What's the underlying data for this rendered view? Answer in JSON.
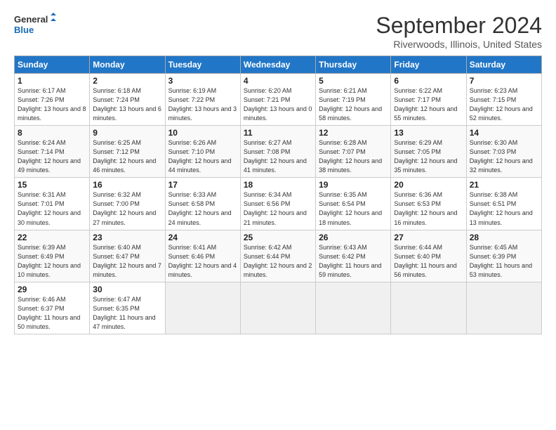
{
  "logo": {
    "line1": "General",
    "line2": "Blue"
  },
  "title": "September 2024",
  "location": "Riverwoods, Illinois, United States",
  "days_of_week": [
    "Sunday",
    "Monday",
    "Tuesday",
    "Wednesday",
    "Thursday",
    "Friday",
    "Saturday"
  ],
  "weeks": [
    [
      {
        "day": "1",
        "sunrise": "6:17 AM",
        "sunset": "7:26 PM",
        "daylight": "13 hours and 8 minutes."
      },
      {
        "day": "2",
        "sunrise": "6:18 AM",
        "sunset": "7:24 PM",
        "daylight": "13 hours and 6 minutes."
      },
      {
        "day": "3",
        "sunrise": "6:19 AM",
        "sunset": "7:22 PM",
        "daylight": "13 hours and 3 minutes."
      },
      {
        "day": "4",
        "sunrise": "6:20 AM",
        "sunset": "7:21 PM",
        "daylight": "13 hours and 0 minutes."
      },
      {
        "day": "5",
        "sunrise": "6:21 AM",
        "sunset": "7:19 PM",
        "daylight": "12 hours and 58 minutes."
      },
      {
        "day": "6",
        "sunrise": "6:22 AM",
        "sunset": "7:17 PM",
        "daylight": "12 hours and 55 minutes."
      },
      {
        "day": "7",
        "sunrise": "6:23 AM",
        "sunset": "7:15 PM",
        "daylight": "12 hours and 52 minutes."
      }
    ],
    [
      {
        "day": "8",
        "sunrise": "6:24 AM",
        "sunset": "7:14 PM",
        "daylight": "12 hours and 49 minutes."
      },
      {
        "day": "9",
        "sunrise": "6:25 AM",
        "sunset": "7:12 PM",
        "daylight": "12 hours and 46 minutes."
      },
      {
        "day": "10",
        "sunrise": "6:26 AM",
        "sunset": "7:10 PM",
        "daylight": "12 hours and 44 minutes."
      },
      {
        "day": "11",
        "sunrise": "6:27 AM",
        "sunset": "7:08 PM",
        "daylight": "12 hours and 41 minutes."
      },
      {
        "day": "12",
        "sunrise": "6:28 AM",
        "sunset": "7:07 PM",
        "daylight": "12 hours and 38 minutes."
      },
      {
        "day": "13",
        "sunrise": "6:29 AM",
        "sunset": "7:05 PM",
        "daylight": "12 hours and 35 minutes."
      },
      {
        "day": "14",
        "sunrise": "6:30 AM",
        "sunset": "7:03 PM",
        "daylight": "12 hours and 32 minutes."
      }
    ],
    [
      {
        "day": "15",
        "sunrise": "6:31 AM",
        "sunset": "7:01 PM",
        "daylight": "12 hours and 30 minutes."
      },
      {
        "day": "16",
        "sunrise": "6:32 AM",
        "sunset": "7:00 PM",
        "daylight": "12 hours and 27 minutes."
      },
      {
        "day": "17",
        "sunrise": "6:33 AM",
        "sunset": "6:58 PM",
        "daylight": "12 hours and 24 minutes."
      },
      {
        "day": "18",
        "sunrise": "6:34 AM",
        "sunset": "6:56 PM",
        "daylight": "12 hours and 21 minutes."
      },
      {
        "day": "19",
        "sunrise": "6:35 AM",
        "sunset": "6:54 PM",
        "daylight": "12 hours and 18 minutes."
      },
      {
        "day": "20",
        "sunrise": "6:36 AM",
        "sunset": "6:53 PM",
        "daylight": "12 hours and 16 minutes."
      },
      {
        "day": "21",
        "sunrise": "6:38 AM",
        "sunset": "6:51 PM",
        "daylight": "12 hours and 13 minutes."
      }
    ],
    [
      {
        "day": "22",
        "sunrise": "6:39 AM",
        "sunset": "6:49 PM",
        "daylight": "12 hours and 10 minutes."
      },
      {
        "day": "23",
        "sunrise": "6:40 AM",
        "sunset": "6:47 PM",
        "daylight": "12 hours and 7 minutes."
      },
      {
        "day": "24",
        "sunrise": "6:41 AM",
        "sunset": "6:46 PM",
        "daylight": "12 hours and 4 minutes."
      },
      {
        "day": "25",
        "sunrise": "6:42 AM",
        "sunset": "6:44 PM",
        "daylight": "12 hours and 2 minutes."
      },
      {
        "day": "26",
        "sunrise": "6:43 AM",
        "sunset": "6:42 PM",
        "daylight": "11 hours and 59 minutes."
      },
      {
        "day": "27",
        "sunrise": "6:44 AM",
        "sunset": "6:40 PM",
        "daylight": "11 hours and 56 minutes."
      },
      {
        "day": "28",
        "sunrise": "6:45 AM",
        "sunset": "6:39 PM",
        "daylight": "11 hours and 53 minutes."
      }
    ],
    [
      {
        "day": "29",
        "sunrise": "6:46 AM",
        "sunset": "6:37 PM",
        "daylight": "11 hours and 50 minutes."
      },
      {
        "day": "30",
        "sunrise": "6:47 AM",
        "sunset": "6:35 PM",
        "daylight": "11 hours and 47 minutes."
      },
      null,
      null,
      null,
      null,
      null
    ]
  ]
}
